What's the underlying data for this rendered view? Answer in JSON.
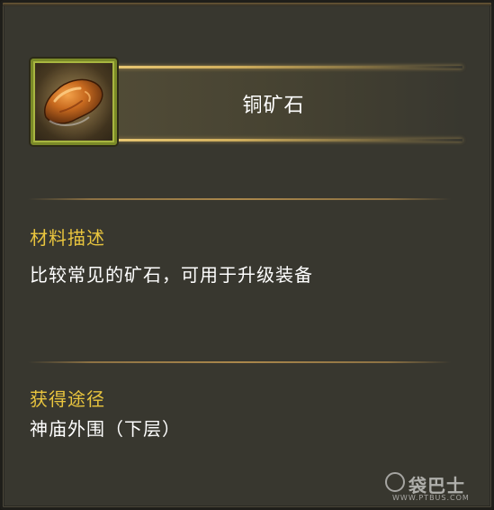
{
  "item": {
    "name": "铜矿石",
    "icon": "copper-ore-icon"
  },
  "description": {
    "title": "材料描述",
    "text": "比较常见的矿石，可用于升级装备"
  },
  "source": {
    "title": "获得途径",
    "text": "神庙外围（下层）"
  },
  "watermark": {
    "name": "袋巴士",
    "url": "WWW.PTBUS.COM"
  },
  "colors": {
    "panel_bg": "#38372f",
    "section_title": "#e9c53e",
    "body_text": "#ffffff",
    "icon_border": "#7b8a28",
    "banner_gold": "#eecd78"
  }
}
